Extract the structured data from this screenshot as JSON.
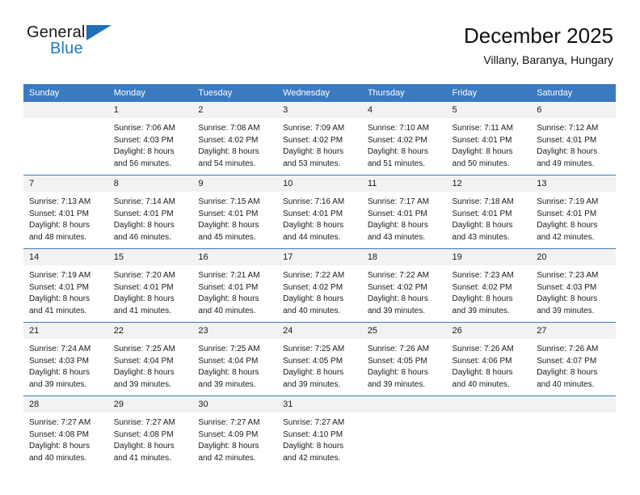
{
  "brand": {
    "name_part1": "General",
    "name_part2": "Blue",
    "triangle_icon": "triangle-logo-icon",
    "accent_color": "#1f7ac0"
  },
  "header": {
    "title": "December 2025",
    "subtitle": "Villany, Baranya, Hungary"
  },
  "colors": {
    "header_blue": "#3a7ac0",
    "daynum_band": "#f2f2f2",
    "text": "#1a1a1a"
  },
  "weekday_headers": [
    "Sunday",
    "Monday",
    "Tuesday",
    "Wednesday",
    "Thursday",
    "Friday",
    "Saturday"
  ],
  "weeks": [
    [
      {
        "day": "",
        "sunrise": "",
        "sunset": "",
        "daylight1": "",
        "daylight2": ""
      },
      {
        "day": "1",
        "sunrise": "Sunrise: 7:06 AM",
        "sunset": "Sunset: 4:03 PM",
        "daylight1": "Daylight: 8 hours",
        "daylight2": "and 56 minutes."
      },
      {
        "day": "2",
        "sunrise": "Sunrise: 7:08 AM",
        "sunset": "Sunset: 4:02 PM",
        "daylight1": "Daylight: 8 hours",
        "daylight2": "and 54 minutes."
      },
      {
        "day": "3",
        "sunrise": "Sunrise: 7:09 AM",
        "sunset": "Sunset: 4:02 PM",
        "daylight1": "Daylight: 8 hours",
        "daylight2": "and 53 minutes."
      },
      {
        "day": "4",
        "sunrise": "Sunrise: 7:10 AM",
        "sunset": "Sunset: 4:02 PM",
        "daylight1": "Daylight: 8 hours",
        "daylight2": "and 51 minutes."
      },
      {
        "day": "5",
        "sunrise": "Sunrise: 7:11 AM",
        "sunset": "Sunset: 4:01 PM",
        "daylight1": "Daylight: 8 hours",
        "daylight2": "and 50 minutes."
      },
      {
        "day": "6",
        "sunrise": "Sunrise: 7:12 AM",
        "sunset": "Sunset: 4:01 PM",
        "daylight1": "Daylight: 8 hours",
        "daylight2": "and 49 minutes."
      }
    ],
    [
      {
        "day": "7",
        "sunrise": "Sunrise: 7:13 AM",
        "sunset": "Sunset: 4:01 PM",
        "daylight1": "Daylight: 8 hours",
        "daylight2": "and 48 minutes."
      },
      {
        "day": "8",
        "sunrise": "Sunrise: 7:14 AM",
        "sunset": "Sunset: 4:01 PM",
        "daylight1": "Daylight: 8 hours",
        "daylight2": "and 46 minutes."
      },
      {
        "day": "9",
        "sunrise": "Sunrise: 7:15 AM",
        "sunset": "Sunset: 4:01 PM",
        "daylight1": "Daylight: 8 hours",
        "daylight2": "and 45 minutes."
      },
      {
        "day": "10",
        "sunrise": "Sunrise: 7:16 AM",
        "sunset": "Sunset: 4:01 PM",
        "daylight1": "Daylight: 8 hours",
        "daylight2": "and 44 minutes."
      },
      {
        "day": "11",
        "sunrise": "Sunrise: 7:17 AM",
        "sunset": "Sunset: 4:01 PM",
        "daylight1": "Daylight: 8 hours",
        "daylight2": "and 43 minutes."
      },
      {
        "day": "12",
        "sunrise": "Sunrise: 7:18 AM",
        "sunset": "Sunset: 4:01 PM",
        "daylight1": "Daylight: 8 hours",
        "daylight2": "and 43 minutes."
      },
      {
        "day": "13",
        "sunrise": "Sunrise: 7:19 AM",
        "sunset": "Sunset: 4:01 PM",
        "daylight1": "Daylight: 8 hours",
        "daylight2": "and 42 minutes."
      }
    ],
    [
      {
        "day": "14",
        "sunrise": "Sunrise: 7:19 AM",
        "sunset": "Sunset: 4:01 PM",
        "daylight1": "Daylight: 8 hours",
        "daylight2": "and 41 minutes."
      },
      {
        "day": "15",
        "sunrise": "Sunrise: 7:20 AM",
        "sunset": "Sunset: 4:01 PM",
        "daylight1": "Daylight: 8 hours",
        "daylight2": "and 41 minutes."
      },
      {
        "day": "16",
        "sunrise": "Sunrise: 7:21 AM",
        "sunset": "Sunset: 4:01 PM",
        "daylight1": "Daylight: 8 hours",
        "daylight2": "and 40 minutes."
      },
      {
        "day": "17",
        "sunrise": "Sunrise: 7:22 AM",
        "sunset": "Sunset: 4:02 PM",
        "daylight1": "Daylight: 8 hours",
        "daylight2": "and 40 minutes."
      },
      {
        "day": "18",
        "sunrise": "Sunrise: 7:22 AM",
        "sunset": "Sunset: 4:02 PM",
        "daylight1": "Daylight: 8 hours",
        "daylight2": "and 39 minutes."
      },
      {
        "day": "19",
        "sunrise": "Sunrise: 7:23 AM",
        "sunset": "Sunset: 4:02 PM",
        "daylight1": "Daylight: 8 hours",
        "daylight2": "and 39 minutes."
      },
      {
        "day": "20",
        "sunrise": "Sunrise: 7:23 AM",
        "sunset": "Sunset: 4:03 PM",
        "daylight1": "Daylight: 8 hours",
        "daylight2": "and 39 minutes."
      }
    ],
    [
      {
        "day": "21",
        "sunrise": "Sunrise: 7:24 AM",
        "sunset": "Sunset: 4:03 PM",
        "daylight1": "Daylight: 8 hours",
        "daylight2": "and 39 minutes."
      },
      {
        "day": "22",
        "sunrise": "Sunrise: 7:25 AM",
        "sunset": "Sunset: 4:04 PM",
        "daylight1": "Daylight: 8 hours",
        "daylight2": "and 39 minutes."
      },
      {
        "day": "23",
        "sunrise": "Sunrise: 7:25 AM",
        "sunset": "Sunset: 4:04 PM",
        "daylight1": "Daylight: 8 hours",
        "daylight2": "and 39 minutes."
      },
      {
        "day": "24",
        "sunrise": "Sunrise: 7:25 AM",
        "sunset": "Sunset: 4:05 PM",
        "daylight1": "Daylight: 8 hours",
        "daylight2": "and 39 minutes."
      },
      {
        "day": "25",
        "sunrise": "Sunrise: 7:26 AM",
        "sunset": "Sunset: 4:05 PM",
        "daylight1": "Daylight: 8 hours",
        "daylight2": "and 39 minutes."
      },
      {
        "day": "26",
        "sunrise": "Sunrise: 7:26 AM",
        "sunset": "Sunset: 4:06 PM",
        "daylight1": "Daylight: 8 hours",
        "daylight2": "and 40 minutes."
      },
      {
        "day": "27",
        "sunrise": "Sunrise: 7:26 AM",
        "sunset": "Sunset: 4:07 PM",
        "daylight1": "Daylight: 8 hours",
        "daylight2": "and 40 minutes."
      }
    ],
    [
      {
        "day": "28",
        "sunrise": "Sunrise: 7:27 AM",
        "sunset": "Sunset: 4:08 PM",
        "daylight1": "Daylight: 8 hours",
        "daylight2": "and 40 minutes."
      },
      {
        "day": "29",
        "sunrise": "Sunrise: 7:27 AM",
        "sunset": "Sunset: 4:08 PM",
        "daylight1": "Daylight: 8 hours",
        "daylight2": "and 41 minutes."
      },
      {
        "day": "30",
        "sunrise": "Sunrise: 7:27 AM",
        "sunset": "Sunset: 4:09 PM",
        "daylight1": "Daylight: 8 hours",
        "daylight2": "and 42 minutes."
      },
      {
        "day": "31",
        "sunrise": "Sunrise: 7:27 AM",
        "sunset": "Sunset: 4:10 PM",
        "daylight1": "Daylight: 8 hours",
        "daylight2": "and 42 minutes."
      },
      {
        "day": "",
        "sunrise": "",
        "sunset": "",
        "daylight1": "",
        "daylight2": ""
      },
      {
        "day": "",
        "sunrise": "",
        "sunset": "",
        "daylight1": "",
        "daylight2": ""
      },
      {
        "day": "",
        "sunrise": "",
        "sunset": "",
        "daylight1": "",
        "daylight2": ""
      }
    ]
  ]
}
